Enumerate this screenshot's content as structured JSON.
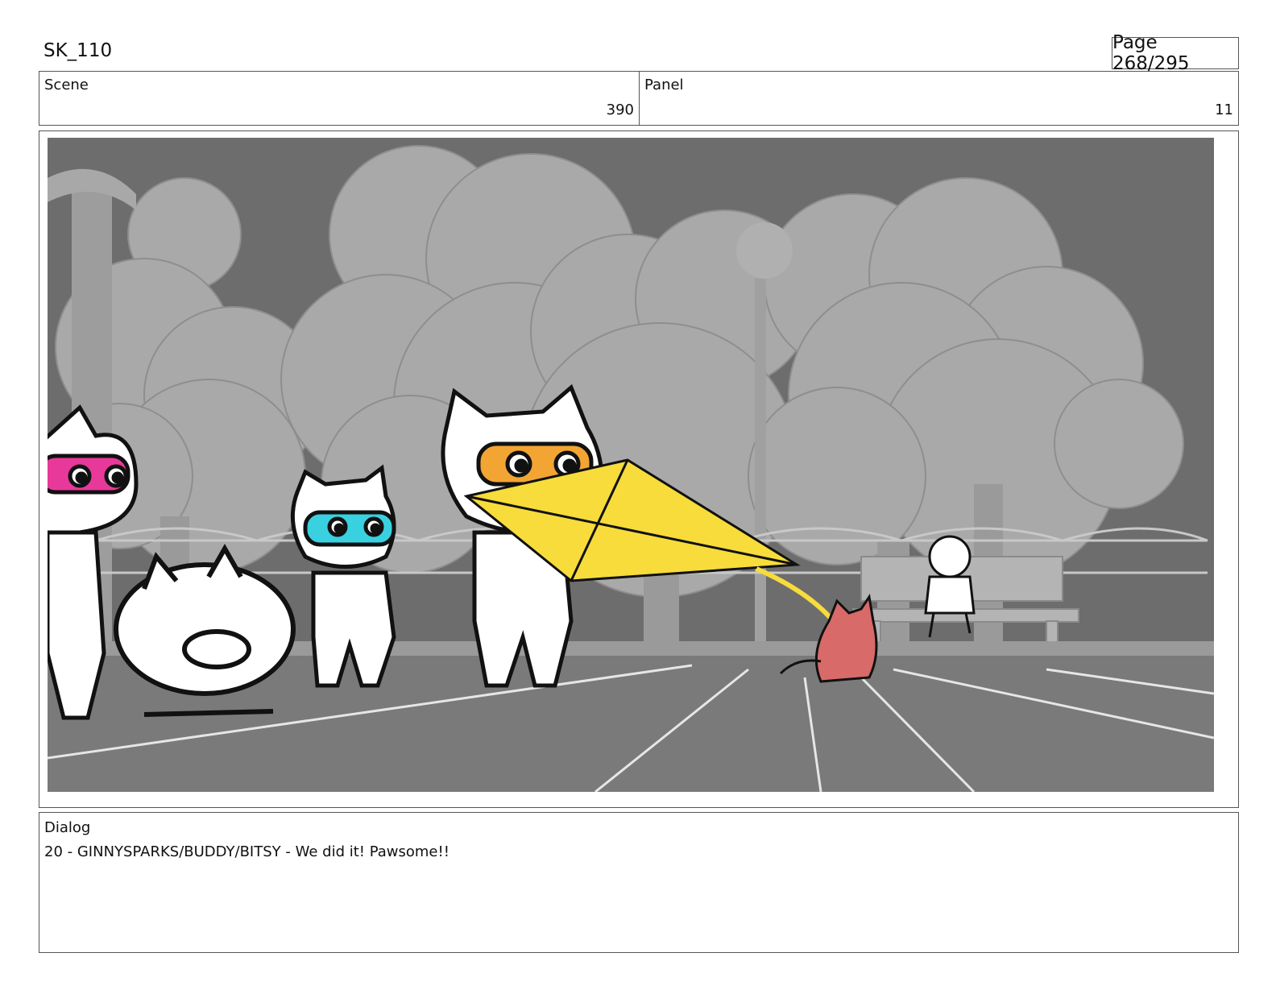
{
  "header": {
    "sheet_id": "SK_110",
    "page": "Page 268/295"
  },
  "scene": {
    "label": "Scene",
    "value": "390"
  },
  "panel": {
    "label": "Panel",
    "value": "11"
  },
  "dialog": {
    "label": "Dialog",
    "line": "20 - GINNYSPARKS/BUDDY/BITSY - We did it! Pawsome!!"
  },
  "colors": {
    "kite": "#f7dc3b",
    "mask_pink": "#e8399b",
    "mask_cyan": "#39d1e0",
    "mask_orange": "#f2a533",
    "red_cat": "#d86a6a",
    "ground": "#7a7a7a",
    "sky": "#6f6f6f"
  }
}
